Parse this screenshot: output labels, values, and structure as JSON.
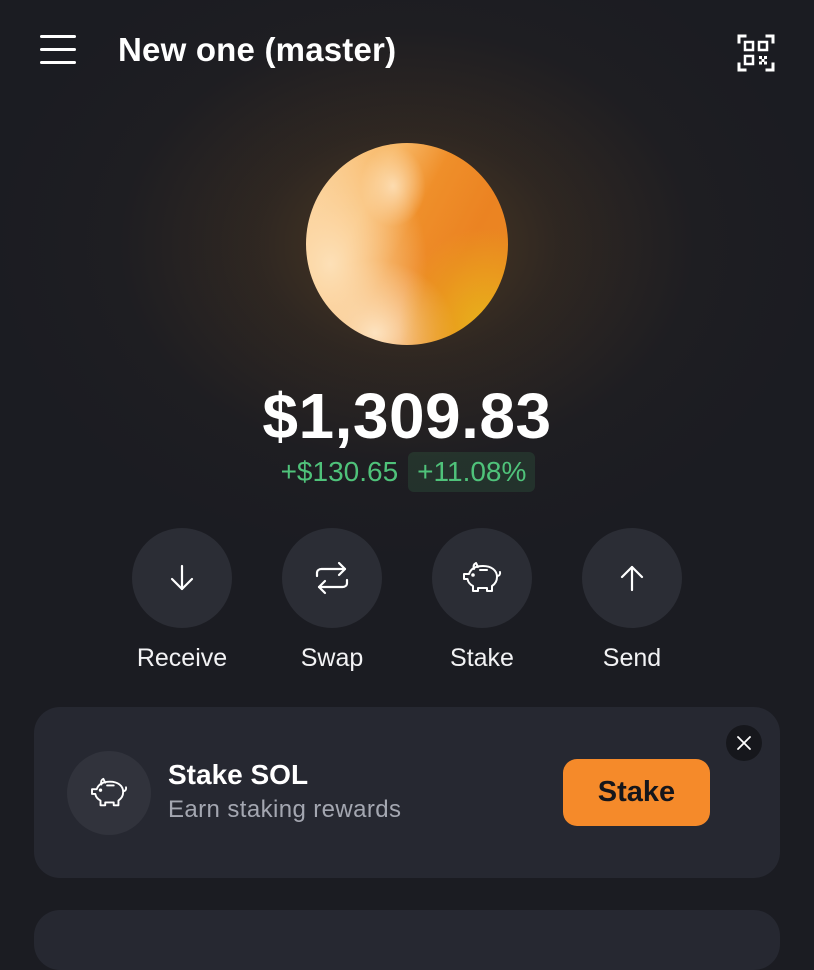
{
  "header": {
    "account_name": "New one (master)",
    "menu_icon": "hamburger-menu-icon",
    "qr_icon": "qr-scan-icon"
  },
  "avatar": {
    "colors": [
      "#fbd39d",
      "#eb8322",
      "#e8b21a"
    ]
  },
  "portfolio": {
    "balance": "$1,309.83",
    "change_amount": "+$130.65",
    "change_percent": "+11.08%",
    "positive_color": "#4fc27a"
  },
  "actions": [
    {
      "label": "Receive",
      "icon": "arrow-down-icon"
    },
    {
      "label": "Swap",
      "icon": "swap-arrows-icon"
    },
    {
      "label": "Stake",
      "icon": "piggy-bank-icon"
    },
    {
      "label": "Send",
      "icon": "arrow-up-icon"
    }
  ],
  "promo": {
    "title": "Stake SOL",
    "subtitle": "Earn staking rewards",
    "button_label": "Stake",
    "icon": "piggy-bank-icon",
    "close_icon": "close-icon",
    "accent_color": "#f58a2a"
  }
}
